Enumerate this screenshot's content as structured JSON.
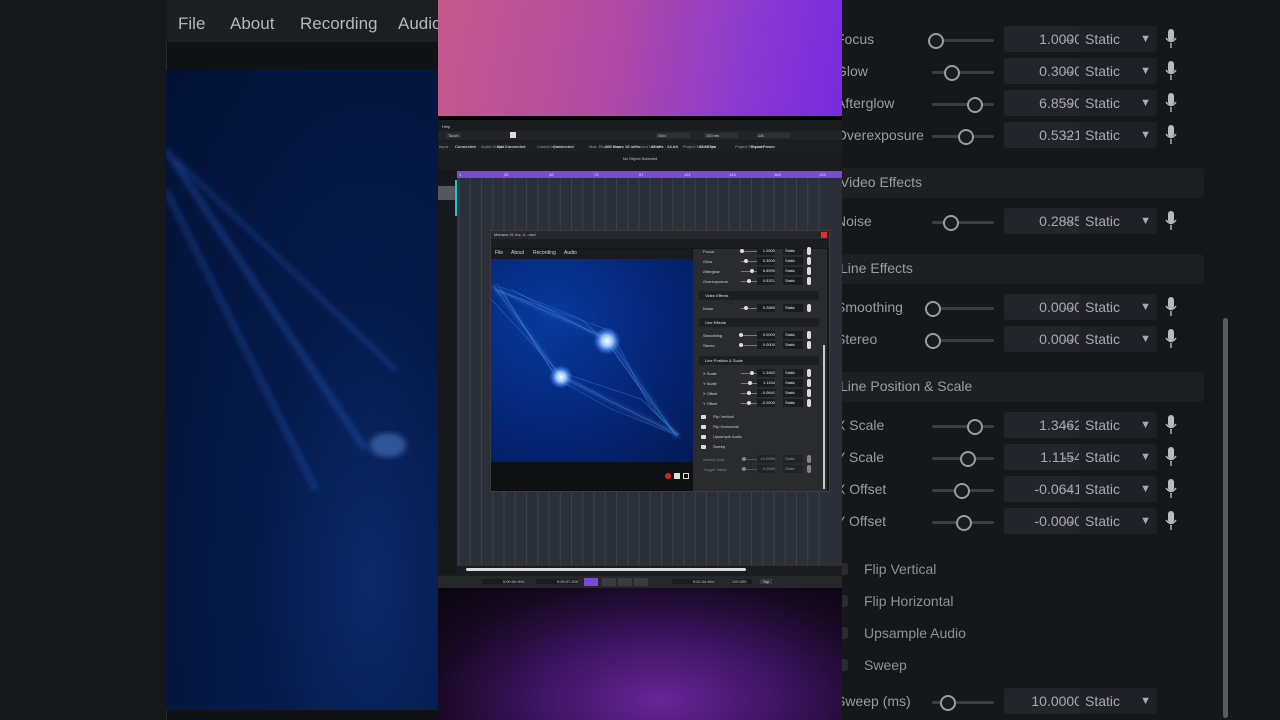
{
  "left_bg": {
    "menu": [
      "File",
      "About",
      "Recording",
      "Audio"
    ]
  },
  "right_bg": {
    "rows_top": [
      {
        "label": "Focus",
        "value": "1.0000",
        "mode": "Static",
        "level": 0.05
      },
      {
        "label": "Glow",
        "value": "0.3000",
        "mode": "Static",
        "level": 0.3
      },
      {
        "label": "Afterglow",
        "value": "6.8590",
        "mode": "Static",
        "level": 0.68
      },
      {
        "label": "Overexposure",
        "value": "0.5321",
        "mode": "Static",
        "level": 0.53
      }
    ],
    "section_video": "Video Effects",
    "rows_video": [
      {
        "label": "Noise",
        "value": "0.2885",
        "mode": "Static",
        "level": 0.29
      }
    ],
    "section_line": "Line Effects",
    "rows_line": [
      {
        "label": "Smoothing",
        "value": "0.0000",
        "mode": "Static",
        "level": 0.0
      },
      {
        "label": "Stereo",
        "value": "0.0000",
        "mode": "Static",
        "level": 0.0
      }
    ],
    "section_pos": "Line Position & Scale",
    "rows_pos": [
      {
        "label": "X Scale",
        "value": "1.3462",
        "mode": "Static",
        "level": 0.67
      },
      {
        "label": "Y Scale",
        "value": "1.1154",
        "mode": "Static",
        "level": 0.56
      },
      {
        "label": "X Offset",
        "value": "-0.0641",
        "mode": "Static",
        "level": 0.47
      },
      {
        "label": "Y Offset",
        "value": "-0.0000",
        "mode": "Static",
        "level": 0.5
      }
    ],
    "checks": [
      "Flip Vertical",
      "Flip Horizontal",
      "Upsample Audio",
      "Sweep"
    ],
    "sweep_row": {
      "label": "Sweep (ms)",
      "value": "10.0000",
      "mode": "Static"
    }
  },
  "daw": {
    "menu_help": "Help",
    "toolbar": [
      "Touch",
      "Grid",
      "100 ms",
      "1/8"
    ],
    "status": [
      {
        "k": "Input",
        "v": "Connected"
      },
      {
        "k": "Audio Output",
        "v": "Not Connected"
      },
      {
        "k": "Control Input",
        "v": "Connected"
      },
      {
        "k": "Max. Record Time",
        "v": "200 hours 15 mins"
      },
      {
        "k": "Record format",
        "v": "48 kHz · 24-bit"
      },
      {
        "k": "Project frame Rate",
        "v": "23.98 fps"
      },
      {
        "k": "Project Pan Law",
        "v": "Equal Power"
      }
    ],
    "no_object": "No Object Selected",
    "ruler_marks": [
      "1",
      "25",
      "49",
      "73",
      "97",
      "121",
      "145",
      "169",
      "193"
    ],
    "transport": {
      "start": "0:00:00.000",
      "end": "0:05:07.200",
      "position": "0:02:44.654",
      "tempo": "120.000",
      "tap": "Tap"
    }
  },
  "scope_window": {
    "title": "Mariana 01 Inc. 4 - osci",
    "menu": [
      "File",
      "About",
      "Recording",
      "Audio"
    ],
    "panel": {
      "rows_top": [
        {
          "label": "Focus",
          "value": "1.0000",
          "mode": "Static",
          "level": 0.05
        },
        {
          "label": "Glow",
          "value": "0.3000",
          "mode": "Static",
          "level": 0.3
        },
        {
          "label": "Afterglow",
          "value": "6.8590",
          "mode": "Static",
          "level": 0.68
        },
        {
          "label": "Overexposure",
          "value": "0.5321",
          "mode": "Static",
          "level": 0.53
        }
      ],
      "section_video": "Video Effects",
      "rows_video": [
        {
          "label": "Noise",
          "value": "0.2885",
          "mode": "Static",
          "level": 0.29
        }
      ],
      "section_line": "Line Effects",
      "rows_line": [
        {
          "label": "Smoothing",
          "value": "0.0000",
          "mode": "Static",
          "level": 0.0
        },
        {
          "label": "Stereo",
          "value": "0.0000",
          "mode": "Static",
          "level": 0.0
        }
      ],
      "section_pos": "Line Position & Scale",
      "rows_pos": [
        {
          "label": "X Scale",
          "value": "1.3462",
          "mode": "Static",
          "level": 0.67
        },
        {
          "label": "Y Scale",
          "value": "1.1154",
          "mode": "Static",
          "level": 0.56
        },
        {
          "label": "X Offset",
          "value": "-0.0641",
          "mode": "Static",
          "level": 0.47
        },
        {
          "label": "Y Offset",
          "value": "-0.0000",
          "mode": "Static",
          "level": 0.5
        }
      ],
      "checks": [
        "Flip Vertical",
        "Flip Horizontal",
        "Upsample Audio",
        "Sweep"
      ],
      "rows_sweep": [
        {
          "label": "Sweep (ms)",
          "value": "10.0000",
          "mode": "Static",
          "level": 0.2
        },
        {
          "label": "Trigger Value",
          "value": "0.0000",
          "mode": "Static",
          "level": 0.2
        }
      ]
    }
  },
  "colors": {
    "accent_purple": "#7a4ad0",
    "scope_blue": "#052a80",
    "record_red": "#e02020"
  }
}
